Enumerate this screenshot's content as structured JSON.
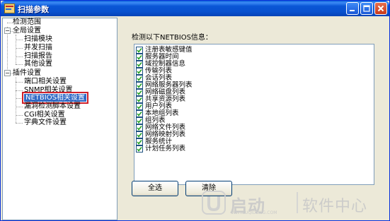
{
  "window": {
    "title": "扫描参数"
  },
  "tree": {
    "items": [
      {
        "label": "检测范围"
      },
      {
        "label": "全局设置",
        "expander": "−"
      },
      {
        "label": "扫描模块"
      },
      {
        "label": "并发扫描"
      },
      {
        "label": "扫描报告"
      },
      {
        "label": "其他设置"
      },
      {
        "label": "插件设置",
        "expander": "−"
      },
      {
        "label": "端口相关设置"
      },
      {
        "label": "SNMP相关设置"
      },
      {
        "label": "NETBIOS相关设置",
        "selected": true
      },
      {
        "label": "漏洞检测脚本设置"
      },
      {
        "label": "CGI相关设置"
      },
      {
        "label": "字典文件设置"
      }
    ]
  },
  "main": {
    "section_label": "检测以下NETBIOS信息：",
    "options": [
      {
        "label": "注册表敏感键值",
        "checked": true
      },
      {
        "label": "服务器时间",
        "checked": true
      },
      {
        "label": "域控制器信息",
        "checked": true
      },
      {
        "label": "传输列表",
        "checked": true
      },
      {
        "label": "会话列表",
        "checked": true
      },
      {
        "label": "网络服务器列表",
        "checked": true
      },
      {
        "label": "网络磁盘列表",
        "checked": true
      },
      {
        "label": "共享资源列表",
        "checked": true
      },
      {
        "label": "用户列表",
        "checked": true
      },
      {
        "label": "本地组列表",
        "checked": true
      },
      {
        "label": "组列表",
        "checked": true
      },
      {
        "label": "网络文件列表",
        "checked": true
      },
      {
        "label": "网络映射列表",
        "checked": true
      },
      {
        "label": "服务统计",
        "checked": true
      },
      {
        "label": "计划任务列表",
        "checked": true
      }
    ],
    "select_all_label": "全选",
    "clear_label": "清除"
  },
  "watermark": {
    "brand": "启动",
    "site": "WWW.UQIDONG.COM",
    "center": "软件中心"
  }
}
